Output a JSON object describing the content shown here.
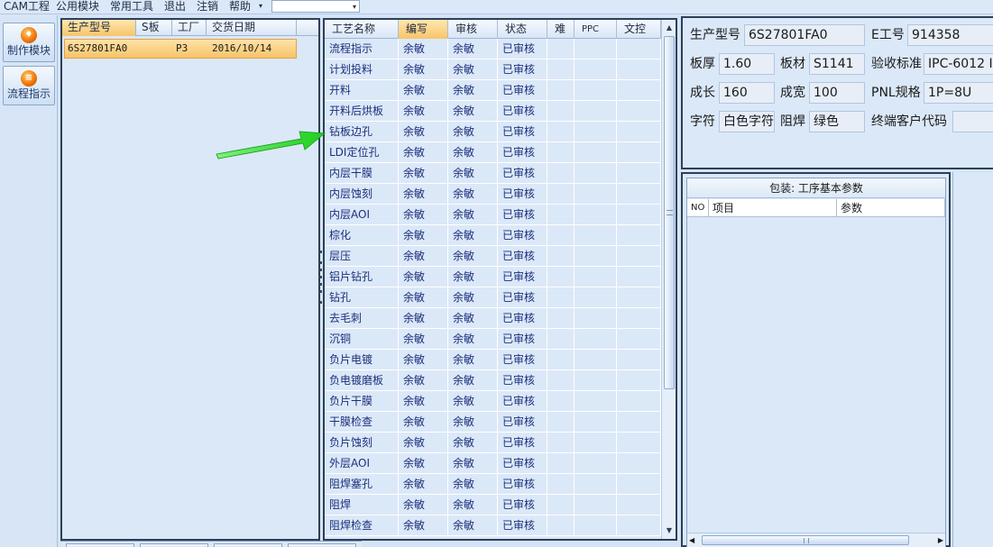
{
  "menu": {
    "items": [
      "CAM工程",
      "公用模块",
      "常用工具",
      "退出",
      "注销",
      "帮助"
    ],
    "combo_value": ""
  },
  "sidebar": {
    "make_label": "制作模块",
    "flow_label": "流程指示"
  },
  "orders": {
    "columns": [
      "生产型号",
      "S板",
      "工厂",
      "交货日期"
    ],
    "rows": [
      {
        "model": "6S27801FA0",
        "factory": "P3",
        "date": "2016/10/14"
      }
    ]
  },
  "process": {
    "columns": [
      "工艺名称",
      "编写",
      "审核",
      "状态",
      "难",
      "PPC",
      "文控"
    ],
    "rows": [
      {
        "name": "流程指示",
        "writer": "余敏",
        "reviewer": "余敏",
        "status": "已审核"
      },
      {
        "name": "计划投料",
        "writer": "余敏",
        "reviewer": "余敏",
        "status": "已审核"
      },
      {
        "name": "开料",
        "writer": "余敏",
        "reviewer": "余敏",
        "status": "已审核"
      },
      {
        "name": "开料后烘板",
        "writer": "余敏",
        "reviewer": "余敏",
        "status": "已审核"
      },
      {
        "name": "钻板边孔",
        "writer": "余敏",
        "reviewer": "余敏",
        "status": "已审核"
      },
      {
        "name": "LDI定位孔",
        "writer": "余敏",
        "reviewer": "余敏",
        "status": "已审核"
      },
      {
        "name": "内层干膜",
        "writer": "余敏",
        "reviewer": "余敏",
        "status": "已审核"
      },
      {
        "name": "内层蚀刻",
        "writer": "余敏",
        "reviewer": "余敏",
        "status": "已审核"
      },
      {
        "name": "内层AOI",
        "writer": "余敏",
        "reviewer": "余敏",
        "status": "已审核"
      },
      {
        "name": "棕化",
        "writer": "余敏",
        "reviewer": "余敏",
        "status": "已审核"
      },
      {
        "name": "层压",
        "writer": "余敏",
        "reviewer": "余敏",
        "status": "已审核"
      },
      {
        "name": "铝片钻孔",
        "writer": "余敏",
        "reviewer": "余敏",
        "status": "已审核"
      },
      {
        "name": "钻孔",
        "writer": "余敏",
        "reviewer": "余敏",
        "status": "已审核"
      },
      {
        "name": "去毛刺",
        "writer": "余敏",
        "reviewer": "余敏",
        "status": "已审核"
      },
      {
        "name": "沉铜",
        "writer": "余敏",
        "reviewer": "余敏",
        "status": "已审核"
      },
      {
        "name": "负片电镀",
        "writer": "余敏",
        "reviewer": "余敏",
        "status": "已审核"
      },
      {
        "name": "负电镀磨板",
        "writer": "余敏",
        "reviewer": "余敏",
        "status": "已审核"
      },
      {
        "name": "负片干膜",
        "writer": "余敏",
        "reviewer": "余敏",
        "status": "已审核"
      },
      {
        "name": "干膜检查",
        "writer": "余敏",
        "reviewer": "余敏",
        "status": "已审核"
      },
      {
        "name": "负片蚀刻",
        "writer": "余敏",
        "reviewer": "余敏",
        "status": "已审核"
      },
      {
        "name": "外层AOI",
        "writer": "余敏",
        "reviewer": "余敏",
        "status": "已审核"
      },
      {
        "name": "阻焊塞孔",
        "writer": "余敏",
        "reviewer": "余敏",
        "status": "已审核"
      },
      {
        "name": "阻焊",
        "writer": "余敏",
        "reviewer": "余敏",
        "status": "已审核"
      },
      {
        "name": "阻焊检查",
        "writer": "余敏",
        "reviewer": "余敏",
        "status": "已审核"
      }
    ]
  },
  "info": {
    "model_label": "生产型号",
    "model_value": "6S27801FA0",
    "eno_label": "E工号",
    "eno_value": "914358",
    "thick_label": "板厚",
    "thick_value": "1.60",
    "material_label": "板材",
    "material_value": "S1141",
    "standard_label": "验收标准",
    "standard_value": "IPC-6012 I",
    "length_label": "成长",
    "length_value": "160",
    "width_label": "成宽",
    "width_value": "100",
    "pnl_label": "PNL规格",
    "pnl_value": "1P=8U",
    "char_label": "字符",
    "char_value": "白色字符",
    "mask_label": "阻焊",
    "mask_value": "绿色",
    "customer_label": "终端客户代码",
    "customer_value": ""
  },
  "params": {
    "title": "包装: 工序基本参数",
    "columns": [
      "NO",
      "项目",
      "参数"
    ]
  },
  "colors": {
    "selection": "#f7c46a",
    "grid_bg": "#dbe8f8",
    "arrow": "#22dd22",
    "text_blue": "#1c2f7a"
  }
}
